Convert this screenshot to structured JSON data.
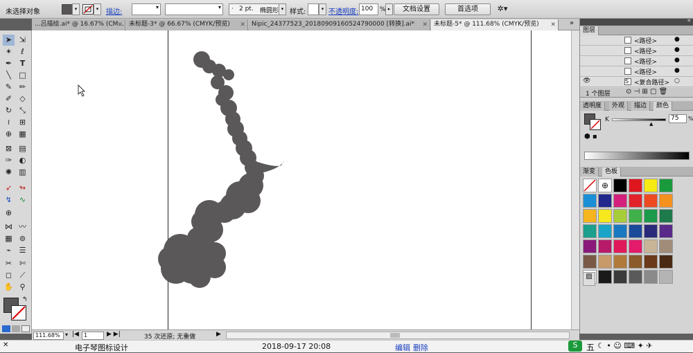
{
  "control_bar": {
    "selection_status": "未选择对象",
    "stroke_label": "描边:",
    "stroke_weight": "2 pt.",
    "brush_name": "椭圆形",
    "style_label": "样式:",
    "opacity_label": "不透明度:",
    "opacity_value": "100",
    "opacity_unit": "%",
    "doc_setup_button": "文档设置",
    "prefs_button": "首选项"
  },
  "document_tabs": [
    {
      "label": "...吕描绘.ai* @ 16.67% (CM...",
      "active": false
    },
    {
      "label": "未标题-3* @ 66.67% (CMYK/预览)",
      "active": false
    },
    {
      "label": "Nipic_24377523_20180909160524790000 [转换].ai*",
      "active": false
    },
    {
      "label": "未标题-5* @ 111.68% (CMYK/预览)",
      "active": true
    }
  ],
  "status_bar": {
    "zoom": "111.68%",
    "page": "1",
    "history": "35 次还原; 无重做"
  },
  "layers_panel": {
    "title": "图层",
    "rows": [
      {
        "label": "<路径>"
      },
      {
        "label": "<路径>"
      },
      {
        "label": "<路径>"
      },
      {
        "label": "<路径>"
      },
      {
        "label": "<复合路径>"
      }
    ],
    "count": "1 个图层"
  },
  "color_panel": {
    "tabs": [
      "透明度",
      "外观",
      "描边",
      "颜色"
    ],
    "active_tab": "颜色",
    "channel": "K",
    "value": "75",
    "unit": "%"
  },
  "swatch_panel": {
    "tabs": [
      "渐变",
      "色板"
    ],
    "active_tab": "色板",
    "colors": [
      "#ffffff",
      "#ffffff",
      "#000000",
      "#e0161f",
      "#f6ea14",
      "#1a9a3c",
      "#1a8fd6",
      "#22288c",
      "#d4207c",
      "#e3232b",
      "#ee4a22",
      "#f5911e",
      "#f6b51e",
      "#f6e81e",
      "#a8cd3a",
      "#3fb04a",
      "#1a9a4a",
      "#1e7a4a",
      "#1aa08c",
      "#1aa5c8",
      "#1a78c0",
      "#1a4a9a",
      "#2a2a7a",
      "#5a2a8a",
      "#8a1a7a",
      "#b81a6a",
      "#e01a5a",
      "#e41a6a",
      "#c8b496",
      "#a08c78",
      "#7a5a46",
      "#c89a6a",
      "#b07a3a",
      "#8a5a2a",
      "#6a3a1a",
      "#4a2a12",
      "#ffffff",
      "#1a1a1a",
      "#3a3a3a",
      "#5a5a5a",
      "#8a8a8a",
      "#b4b4b4"
    ]
  },
  "taskbar": {
    "left_text": "电子琴图标设计",
    "date": "2018-09-17 20:08",
    "links": [
      "编辑",
      "删除"
    ],
    "ime_label": "五"
  },
  "shape_fill": "#5b585a"
}
